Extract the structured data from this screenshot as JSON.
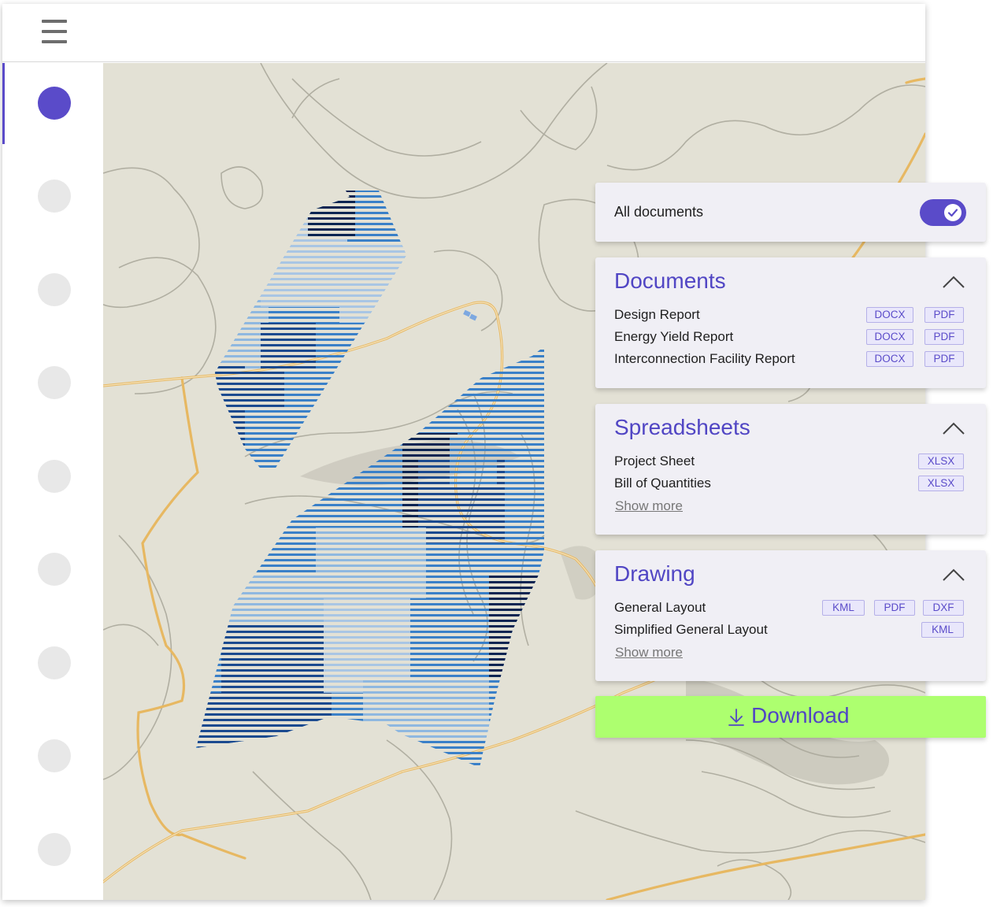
{
  "all_documents": {
    "label": "All documents",
    "enabled": true
  },
  "sections": {
    "documents": {
      "title": "Documents",
      "rows": [
        {
          "label": "Design Report",
          "formats": [
            "DOCX",
            "PDF"
          ]
        },
        {
          "label": "Energy Yield Report",
          "formats": [
            "DOCX",
            "PDF"
          ]
        },
        {
          "label": "Interconnection Facility Report",
          "formats": [
            "DOCX",
            "PDF"
          ]
        }
      ]
    },
    "spreadsheets": {
      "title": "Spreadsheets",
      "rows": [
        {
          "label": "Project Sheet",
          "formats": [
            "XLSX"
          ]
        },
        {
          "label": "Bill of Quantities",
          "formats": [
            "XLSX"
          ]
        }
      ],
      "show_more": "Show more"
    },
    "drawing": {
      "title": "Drawing",
      "rows": [
        {
          "label": "General Layout",
          "formats": [
            "KML",
            "PDF",
            "DXF"
          ]
        },
        {
          "label": "Simplified General Layout",
          "formats": [
            "KML"
          ]
        }
      ],
      "show_more": "Show more"
    }
  },
  "download": {
    "label": "Download"
  },
  "icons": {
    "menu": "hamburger-menu-icon",
    "toggle_check": "check-icon",
    "collapse": "chevron-up-icon",
    "download": "download-arrow-icon"
  },
  "colors": {
    "accent": "#5a4bc9",
    "download_bg": "#adff6f",
    "map_bg": "#e3e1d5",
    "road": "#e8b45a"
  }
}
